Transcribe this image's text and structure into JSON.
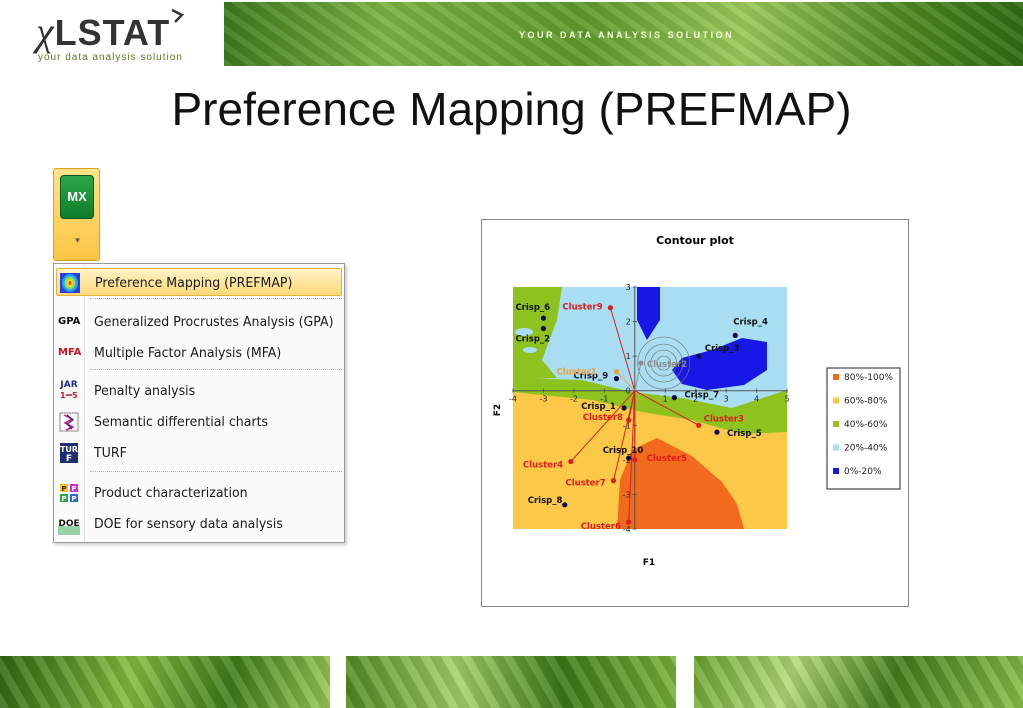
{
  "header": {
    "logo_text": "XLSTAT",
    "logo_tagline": "your data analysis solution",
    "banner_text": "YOUR DATA ANALYSIS SOLUTION"
  },
  "title": "Preference Mapping (PREFMAP)",
  "ribbon": {
    "button_label": "MX",
    "arrow": "▾"
  },
  "menu": {
    "items": [
      {
        "label": "Preference Mapping (PREFMAP)",
        "icon_text": "",
        "icon": "prefmap-icon"
      },
      {
        "label": "Generalized Procrustes Analysis (GPA)",
        "icon_text": "GPA",
        "icon": "gpa-icon"
      },
      {
        "label": "Multiple Factor Analysis (MFA)",
        "icon_text": "MFA",
        "icon": "mfa-icon"
      },
      {
        "label": "Penalty analysis",
        "icon_text": "JAR",
        "icon": "penalty-icon"
      },
      {
        "label": "Semantic differential charts",
        "icon_text": "",
        "icon": "semantic-differential-icon"
      },
      {
        "label": "TURF",
        "icon_text": "TUR",
        "icon": "turf-icon"
      },
      {
        "label": "Product characterization",
        "icon_text": "",
        "icon": "product-characterization-icon"
      },
      {
        "label": "DOE for sensory data analysis",
        "icon_text": "DOE",
        "icon": "doe-icon"
      }
    ]
  },
  "chart_data": {
    "type": "scatter",
    "title": "Contour plot",
    "xlabel": "F1",
    "ylabel": "F2",
    "xlim": [
      -4,
      5
    ],
    "ylim": [
      -4,
      3
    ],
    "xticks": [
      -4,
      -3,
      -2,
      -1,
      0,
      1,
      2,
      3,
      4,
      5
    ],
    "yticks": [
      -4,
      -3,
      -2,
      -1,
      0,
      1,
      2,
      3
    ],
    "legend": {
      "placement": "right",
      "items": [
        {
          "label": "80%-100%",
          "color": "#f26a1b"
        },
        {
          "label": "60%-80%",
          "color": "#fbc947"
        },
        {
          "label": "40%-60%",
          "color": "#8dc21f"
        },
        {
          "label": "20%-40%",
          "color": "#a9def2"
        },
        {
          "label": "0%-20%",
          "color": "#1818e6"
        }
      ]
    },
    "products": [
      {
        "name": "Crisp_6",
        "x": -3.0,
        "y": 2.1
      },
      {
        "name": "Crisp_2",
        "x": -3.0,
        "y": 1.8
      },
      {
        "name": "Crisp_4",
        "x": 3.3,
        "y": 1.6
      },
      {
        "name": "Crisp_3",
        "x": 2.1,
        "y": 1.0
      },
      {
        "name": "Crisp_9",
        "x": -0.6,
        "y": 0.35
      },
      {
        "name": "Crisp_7",
        "x": 1.3,
        "y": -0.2
      },
      {
        "name": "Crisp_1",
        "x": -0.35,
        "y": -0.5
      },
      {
        "name": "Crisp_5",
        "x": 2.7,
        "y": -1.2
      },
      {
        "name": "Crisp_10",
        "x": -0.2,
        "y": -1.95
      },
      {
        "name": "Crisp_8",
        "x": -2.3,
        "y": -3.3
      }
    ],
    "clusters": [
      {
        "name": "Cluster9",
        "x": -0.8,
        "y": 2.4
      },
      {
        "name": "Cluster1",
        "x": -0.6,
        "y": 0.55
      },
      {
        "name": "Cluster2",
        "x": 0.2,
        "y": 0.8
      },
      {
        "name": "Cluster3",
        "x": 2.1,
        "y": -1.0
      },
      {
        "name": "Cluster8",
        "x": -0.2,
        "y": -0.85
      },
      {
        "name": "Cluster5",
        "x": 0.0,
        "y": -2.0
      },
      {
        "name": "Cluster4",
        "x": -2.1,
        "y": -2.05
      },
      {
        "name": "Cluster7",
        "x": -0.7,
        "y": -2.6
      },
      {
        "name": "Cluster6",
        "x": -0.2,
        "y": -3.8
      }
    ],
    "colors": {
      "product": "#0a0a4a",
      "cluster": "#dc1e1e",
      "cluster1": "#e9a23b",
      "cluster2": "#8c8c8c"
    }
  }
}
